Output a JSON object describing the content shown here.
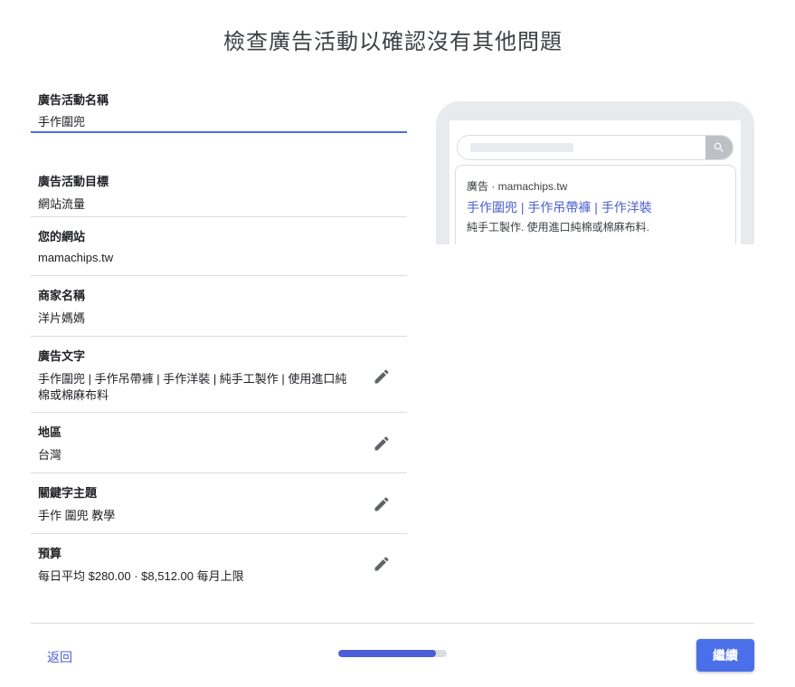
{
  "header": {
    "title": "檢查廣告活動以確認沒有其他問題"
  },
  "fields": {
    "campaign_name": {
      "label": "廣告活動名稱",
      "value": "手作圍兜"
    },
    "goal": {
      "label": "廣告活動目標",
      "value": "網站流量"
    },
    "website": {
      "label": "您的網站",
      "value": "mamachips.tw"
    },
    "business_name": {
      "label": "商家名稱",
      "value": "洋片媽媽"
    },
    "ad_text": {
      "label": "廣告文字",
      "value": "手作圍兜 | 手作吊帶褲 | 手作洋裝 | 純手工製作 | 使用進口純棉或棉麻布料",
      "edit_icon": "pencil-icon"
    },
    "region": {
      "label": "地區",
      "value": "台灣",
      "edit_icon": "pencil-icon"
    },
    "keywords": {
      "label": "關鍵字主題",
      "value": "手作 圍兜 教學",
      "edit_icon": "pencil-icon"
    },
    "budget": {
      "label": "預算",
      "value": "每日平均 $280.00 · $8,512.00 每月上限",
      "edit_icon": "pencil-icon"
    }
  },
  "preview": {
    "search_icon": "search-icon",
    "ad_meta": "廣告 · mamachips.tw",
    "headline": "手作圍兜 | 手作吊帶褲 | 手作洋裝",
    "description": "純手工製作. 使用進口純棉或棉麻布料."
  },
  "footer": {
    "back_label": "返回",
    "continue_label": "繼續",
    "progress": 0.9
  },
  "colors": {
    "accent": "#4a6fe8",
    "link": "#4a5fd0",
    "divider": "#dadce0"
  }
}
